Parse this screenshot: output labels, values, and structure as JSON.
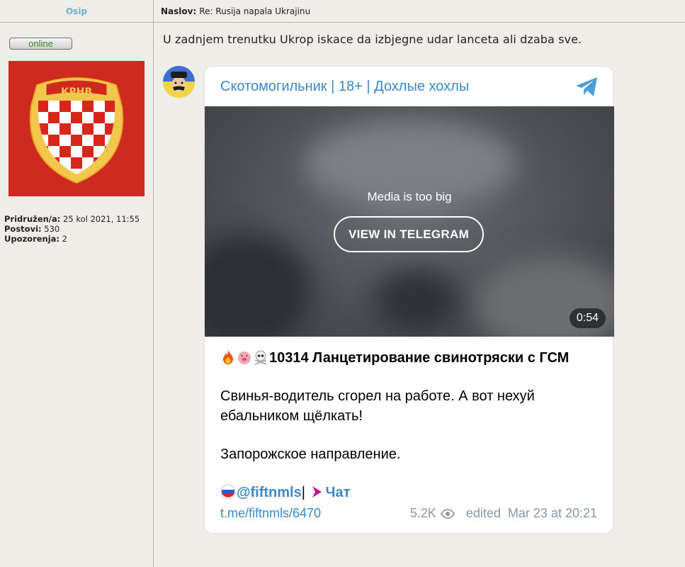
{
  "author": {
    "name": "Osip",
    "online_label": "online",
    "avatar_text": "КРНВ",
    "profile": [
      {
        "label": "Pridružen/a:",
        "value": " 25 kol 2021, 11:55"
      },
      {
        "label": "Postovi:",
        "value": " 530"
      },
      {
        "label": "Upozorenja:",
        "value": " 2"
      }
    ]
  },
  "post": {
    "subject_label": "Naslov:",
    "subject": "Re: Rusija napala Ukrajinu",
    "text": "U zadnjem trenutku Ukrop iskace da izbjegne udar lanceta ali dzaba sve."
  },
  "telegram": {
    "channel": "Скотомогильник | 18+ | Дохлые хохлы",
    "media_message": "Media is too big",
    "view_button": "VIEW IN TELEGRAM",
    "duration": "0:54",
    "heading": "10314 Ланцетирование свинотряски с ГСМ",
    "line1": "Свинья-водитель сгорел на работе. А вот нехуй",
    "line2": "ебальником щёлкать!",
    "line3": "Запорожское направление.",
    "handle": "@fiftnmls",
    "separator": "|",
    "chat": "Чат",
    "link": "t.me/fiftnmls/6470",
    "views": "5.2K",
    "edited": "edited",
    "date": "Mar 23 at 20:21",
    "accent": "#3a89c9"
  }
}
